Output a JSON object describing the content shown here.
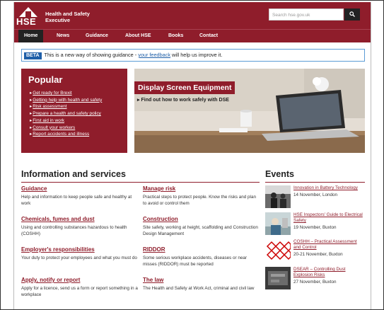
{
  "header": {
    "logo_text": "HSE",
    "brand_line1": "Health and Safety",
    "brand_line2": "Executive",
    "search_placeholder": "Search hse.gov.uk",
    "search_icon": "search-icon",
    "brand_color": "#8f1d2b"
  },
  "nav": {
    "items": [
      {
        "label": "Home"
      },
      {
        "label": "News"
      },
      {
        "label": "Guidance"
      },
      {
        "label": "About HSE"
      },
      {
        "label": "Books"
      },
      {
        "label": "Contact"
      }
    ]
  },
  "beta": {
    "tag": "BETA",
    "text_before": "This is a new way of showing guidance - ",
    "link": "your feedback",
    "text_after": " will help us improve it."
  },
  "popular": {
    "title": "Popular",
    "items": [
      {
        "label": "Get ready for Brexit"
      },
      {
        "label": "Getting help with health and safety"
      },
      {
        "label": "Risk assessment"
      },
      {
        "label": "Prepare a health and safety policy"
      },
      {
        "label": "First aid in work"
      },
      {
        "label": "Consult your workers"
      },
      {
        "label": "Report accidents and illness"
      }
    ]
  },
  "feature": {
    "title": "Display Screen Equipment",
    "subtitle": "Find out how to work safely with DSE"
  },
  "info": {
    "title": "Information and services",
    "items": [
      {
        "title": "Guidance",
        "desc": "Help and information to keep people safe and healthy at work"
      },
      {
        "title": "Manage risk",
        "desc": "Practical steps to protect people. Know the risks and plan to avoid or control them"
      },
      {
        "title": "Chemicals, fumes and dust",
        "desc": "Using and controlling substances hazardous to health (COSHH)"
      },
      {
        "title": "Construction",
        "desc": "Site safety, working at height, scaffolding and Construction Design Management"
      },
      {
        "title": "Employer's responsibilities",
        "desc": "Your duty to protect your employees and what you must do"
      },
      {
        "title": "RIDDOR",
        "desc": "Some serious workplace accidents, diseases or near misses (RIDDOR) must be reported"
      },
      {
        "title": "Apply, notify or report",
        "desc": "Apply for a licence, send us a form or report something in a workplace"
      },
      {
        "title": "The law",
        "desc": "The Health and Safety at Work Act, criminal and civil law"
      }
    ]
  },
  "events": {
    "title": "Events",
    "items": [
      {
        "title": "Innovation in Battery Technology",
        "detail": "14 November, London"
      },
      {
        "title": "HSE Inspectors' Guide to Electrical Safety",
        "detail": "19 November, Buxton"
      },
      {
        "title": "COSHH – Practical Assessment and Control",
        "detail": "20-21 November, Buxton"
      },
      {
        "title": "DSEAR – Controlling Dust Explosion Risks",
        "detail": "27 November, Buxton"
      }
    ]
  }
}
